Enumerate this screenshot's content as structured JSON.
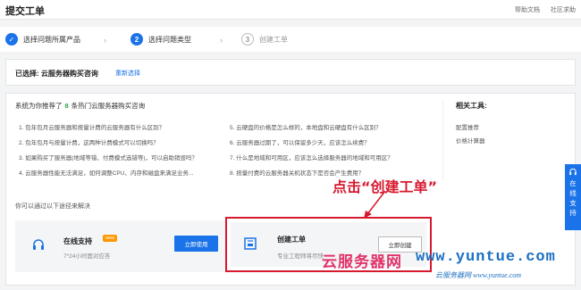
{
  "header": {
    "title": "提交工单",
    "links": [
      "帮助文档",
      "社区求助"
    ]
  },
  "steps": [
    {
      "num": "✓",
      "label": "选择问题所属产品",
      "state": "done"
    },
    {
      "num": "2",
      "label": "选择问题类型",
      "state": "active"
    },
    {
      "num": "3",
      "label": "创建工单",
      "state": "todo"
    }
  ],
  "step_separator": "›",
  "selected": {
    "label": "已选择: 云服务器购买咨询",
    "reselect": "重新选择"
  },
  "recommend": {
    "prefix": "系统为你推荐了",
    "count": "8",
    "suffix": "条热门云服务器购买咨询",
    "questions": [
      "1. 包年包月云服务器和按量计费的云服务器有什么区别？",
      "2. 包年包月与按量计费，这两种计费模式可以切换吗？",
      "3. 如果购买了服务器(地域等错、付费模式选错等)，可以启助销毁吗？",
      "4. 云服务器性能无法满足，如何调整CPU、内存和磁盘来满足业务...",
      "5. 云硬盘的价格是怎么样的，本地盘和云硬盘有什么区别？",
      "6. 云服务器过期了，可以保留多少天，应该怎么续费？",
      "7. 什么是地域和可用区，应该怎么选择服务器的地域和可用区？",
      "8. 按量付费的云服务器关机状态下是否会产生费用？"
    ]
  },
  "tools": {
    "title": "相关工具:",
    "items": [
      "配置推荐",
      "价格计算器"
    ]
  },
  "alt_title": "你可以通过以下途径来解决",
  "online": {
    "title": "在线支持",
    "badge": "new",
    "sub": "7*24小时面对应答",
    "button": "立即使用"
  },
  "ticket": {
    "title": "创建工单",
    "sub": "专业工程师将尽快",
    "button": "立即创建"
  },
  "annotation": "点击“创建工单”",
  "side_tab": [
    "在",
    "线",
    "支",
    "持"
  ],
  "watermark": {
    "cn": "云服务器网",
    "url": "www.yuntue.com",
    "sub": "云服务器网 www.yuntue.com"
  },
  "colors": {
    "primary": "#1a73e8",
    "highlight": "#d7192f",
    "count": "#28a745",
    "badge": "#ff9800"
  }
}
